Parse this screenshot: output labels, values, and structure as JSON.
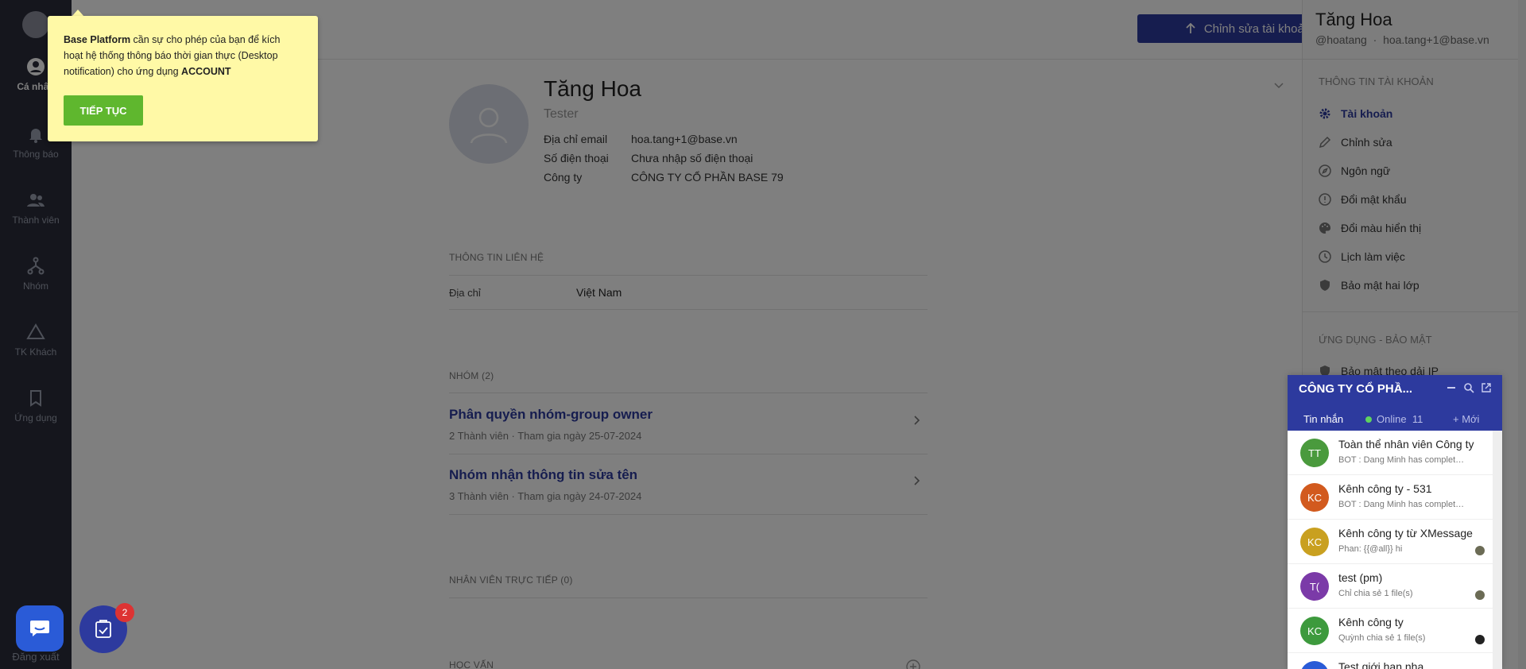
{
  "sidebar": {
    "items": [
      {
        "label": "Cá nhân",
        "icon": "user-circle-icon"
      },
      {
        "label": "Thông báo",
        "icon": "bell-icon"
      },
      {
        "label": "Thành viên",
        "icon": "users-icon"
      },
      {
        "label": "Nhóm",
        "icon": "hierarchy-icon"
      },
      {
        "label": "TK Khách",
        "icon": "triangle-icon"
      },
      {
        "label": "Ứng dụng",
        "icon": "bookmark-icon"
      }
    ],
    "logout": "Đăng xuất"
  },
  "header": {
    "edit_button": "Chỉnh sửa tài khoản"
  },
  "profile": {
    "name": "Tăng Hoa",
    "title": "Tester",
    "email_label": "Địa chỉ email",
    "email": "hoa.tang+1@base.vn",
    "phone_label": "Số điện thoại",
    "phone": "Chưa nhập số điện thoại",
    "company_label": "Công ty",
    "company": "CÔNG TY CỔ PHẦN BASE 79"
  },
  "contact": {
    "section": "THÔNG TIN LIÊN HỆ",
    "address_label": "Địa chỉ",
    "address": "Việt Nam"
  },
  "groups": {
    "section": "NHÓM (2)",
    "items": [
      {
        "name": "Phân quyền nhóm-group owner",
        "meta": "2 Thành viên · Tham gia ngày 25-07-2024"
      },
      {
        "name": "Nhóm nhận thông tin sửa tên",
        "meta": "3 Thành viên · Tham gia ngày 24-07-2024"
      }
    ]
  },
  "direct_reports": {
    "section": "NHÂN VIÊN TRỰC TIẾP (0)"
  },
  "education": {
    "section": "HỌC VẤN"
  },
  "right_panel": {
    "name": "Tăng Hoa",
    "handle": "@hoatang",
    "email": "hoa.tang+1@base.vn",
    "account_section": "THÔNG TIN TÀI KHOẢN",
    "menu": [
      {
        "label": "Tài khoản",
        "icon": "gear-icon"
      },
      {
        "label": "Chỉnh sửa",
        "icon": "pencil-icon"
      },
      {
        "label": "Ngôn ngữ",
        "icon": "compass-icon"
      },
      {
        "label": "Đổi mật khẩu",
        "icon": "alert-circle-icon"
      },
      {
        "label": "Đổi màu hiển thị",
        "icon": "palette-icon"
      },
      {
        "label": "Lịch làm việc",
        "icon": "clock-icon"
      },
      {
        "label": "Bảo mật hai lớp",
        "icon": "shield-icon"
      }
    ],
    "security_section": "ỨNG DỤNG - BẢO MẬT",
    "ip_item": "Bảo mật theo dải IP"
  },
  "popup": {
    "brand": "Base Platform",
    "text": " cần sự cho phép của bạn để kích hoạt hệ thống thông báo thời gian thực (Desktop notification) cho ứng dụng ",
    "app": "ACCOUNT",
    "button": "TIẾP TỤC"
  },
  "chat": {
    "title": "CÔNG TY CỔ PHẦ...",
    "tab_messages": "Tin nhắn",
    "online_label": "Online",
    "online_count": "11",
    "new_label": "+ Mới",
    "items": [
      {
        "initials": "TT",
        "color": "#4a9a3d",
        "name": "Toàn thể nhân viên Công ty",
        "msg": "BOT : Dang Minh has complete..."
      },
      {
        "initials": "KC",
        "color": "#d25a1e",
        "name": "Kênh công ty - 531",
        "msg": "BOT : Dang Minh has complete..."
      },
      {
        "initials": "KC",
        "color": "#c9a020",
        "name": "Kênh công ty từ XMessage",
        "msg": "Phan: {{@all}} hi"
      },
      {
        "initials": "T(",
        "color": "#7b3aa8",
        "name": "test (pm)",
        "msg": "Chỉ chia sẻ 1 file(s)"
      },
      {
        "initials": "KC",
        "color": "#3d9a3d",
        "name": "Kênh công ty",
        "msg": "Quỳnh chia sẻ 1 file(s)"
      },
      {
        "initials": "",
        "color": "#2a5bd7",
        "name": "Test giới hạn nha",
        "msg": ""
      }
    ]
  },
  "task_badge": "2"
}
